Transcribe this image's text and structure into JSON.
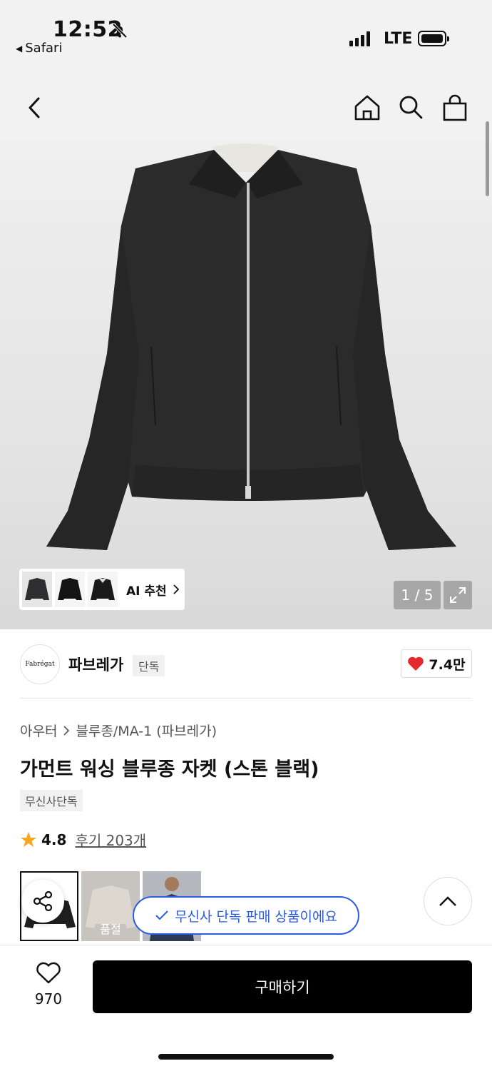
{
  "status_bar": {
    "time": "12:52",
    "back_app": "Safari",
    "network": "LTE",
    "icons": [
      "bell-slash-icon",
      "signal-icon",
      "battery-icon"
    ]
  },
  "nav": {
    "icons": [
      "back-chevron-icon",
      "home-icon",
      "search-icon",
      "shopping-bag-icon"
    ]
  },
  "gallery": {
    "counter": "1 / 5",
    "ai_recommend_label": "AI 추천",
    "icons": [
      "chevron-right-icon",
      "expand-icon"
    ]
  },
  "brand": {
    "logo_text": "Fabrégat",
    "name": "파브레가",
    "badge": "단독",
    "likes": "7.4만",
    "like_color": "#e5282d"
  },
  "product": {
    "breadcrumb": [
      "아우터",
      "블루종/MA-1 (파브레가)"
    ],
    "title": "가먼트 워싱 블루종 자켓 (스톤 블랙)",
    "tag": "무신사단독",
    "rating": "4.8",
    "reviews": "후기 203개",
    "star_color": "#f5a623"
  },
  "options": {
    "soldout_label": "품절"
  },
  "toast": {
    "text": "무신사 단독 판매 상품이에요",
    "accent": "#2c5be5"
  },
  "bottom": {
    "wish_count": "970",
    "buy_label": "구매하기"
  }
}
